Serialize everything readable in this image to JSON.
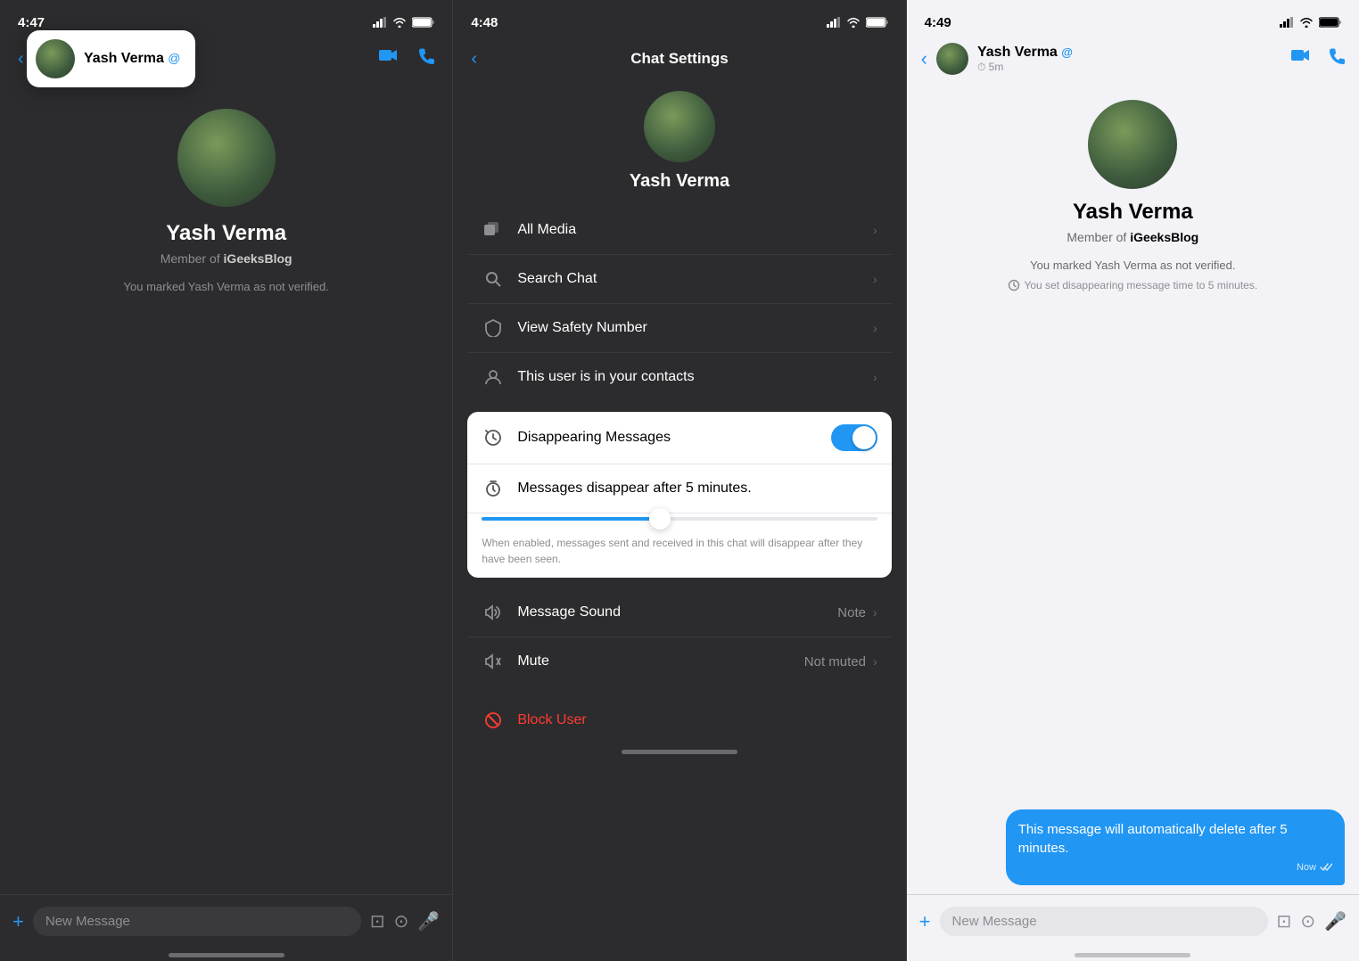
{
  "phone1": {
    "statusBar": {
      "time": "4:47",
      "signal": "signal",
      "wifi": "wifi",
      "battery": "battery"
    },
    "tooltip": {
      "name": "Yash Verma",
      "verified": "@"
    },
    "user": {
      "name": "Yash Verma",
      "memberOf": "Member of",
      "group": "iGeeksBlog",
      "verifiedStatus": "You marked Yash Verma as not verified."
    },
    "messageBar": {
      "plusLabel": "+",
      "placeholder": "New Message"
    }
  },
  "phone2": {
    "statusBar": {
      "time": "4:48"
    },
    "header": {
      "title": "Chat Settings",
      "backLabel": "‹"
    },
    "user": {
      "name": "Yash Verma"
    },
    "menuItems": [
      {
        "icon": "🖼",
        "label": "All Media"
      },
      {
        "icon": "🔍",
        "label": "Search Chat"
      },
      {
        "icon": "🛡",
        "label": "View Safety Number"
      },
      {
        "icon": "👤",
        "label": "This user is in your contacts"
      }
    ],
    "disappearingMessages": {
      "toggleLabel": "Disappearing Messages",
      "toggleOn": true,
      "durationLabel": "Messages disappear after 5 minutes.",
      "sliderPercent": 45,
      "hint": "When enabled, messages sent and received in this chat will disappear after they have been seen."
    },
    "bottomMenu": [
      {
        "icon": "🔔",
        "label": "Message Sound",
        "value": "Note"
      },
      {
        "icon": "🔕",
        "label": "Mute",
        "value": "Not muted"
      }
    ],
    "blockUser": {
      "label": "Block User"
    }
  },
  "phone3": {
    "statusBar": {
      "time": "4:49"
    },
    "nav": {
      "userName": "Yash Verma",
      "userStatus": "⏱ 5m",
      "verified": "@"
    },
    "user": {
      "name": "Yash Verma",
      "memberOf": "Member of",
      "group": "iGeeksBlog",
      "verifiedStatus": "You marked Yash Verma as not verified.",
      "disappearingNotice": "You set disappearing message time to 5 minutes."
    },
    "message": {
      "text": "This message will automatically delete after 5 minutes.",
      "time": "Now",
      "icons": "⏱ ✓✓"
    },
    "messageBar": {
      "plusLabel": "+",
      "placeholder": "New Message"
    }
  }
}
